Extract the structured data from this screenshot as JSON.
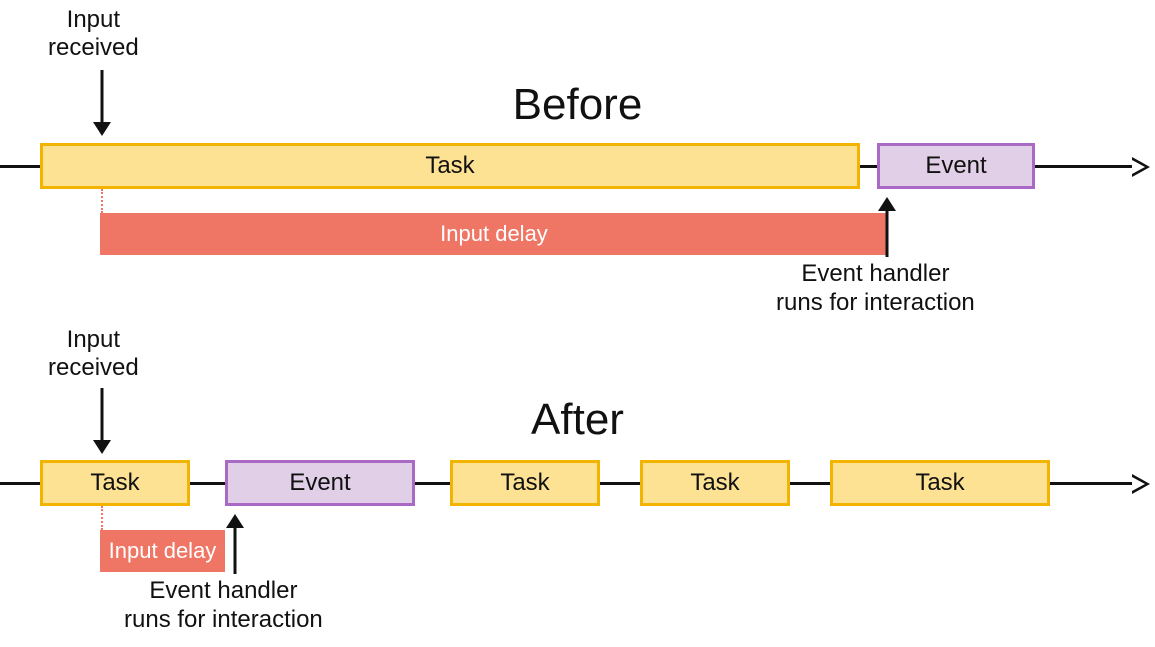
{
  "before": {
    "title": "Before",
    "input_label": "Input\nreceived",
    "task_label": "Task",
    "event_label": "Event",
    "delay_label": "Input delay",
    "handler_label": "Event handler\nruns for interaction"
  },
  "after": {
    "title": "After",
    "input_label": "Input\nreceived",
    "task_labels": [
      "Task",
      "Task",
      "Task",
      "Task"
    ],
    "event_label": "Event",
    "delay_label": "Input delay",
    "handler_label": "Event handler\nruns for interaction"
  },
  "colors": {
    "task_fill": "#fde293",
    "task_border": "#f3b401",
    "event_fill": "#e1cfe8",
    "event_border": "#ab69c6",
    "delay_fill": "#ef7564",
    "line": "#111111"
  },
  "chart_data": {
    "type": "timeline-diagram",
    "description": "Comparison of input delay before and after breaking a long task into smaller chunks.",
    "before": {
      "timeline": [
        {
          "kind": "task",
          "label": "Task",
          "approx_width_share": 0.74
        },
        {
          "kind": "event",
          "label": "Event",
          "approx_width_share": 0.14
        }
      ],
      "input_received_at_share": 0.06,
      "input_delay_span_share": [
        0.06,
        0.8
      ],
      "event_handler_at_share": 0.8
    },
    "after": {
      "timeline": [
        {
          "kind": "task",
          "label": "Task",
          "approx_width_share": 0.13
        },
        {
          "kind": "event",
          "label": "Event",
          "approx_width_share": 0.17
        },
        {
          "kind": "task",
          "label": "Task",
          "approx_width_share": 0.13
        },
        {
          "kind": "task",
          "label": "Task",
          "approx_width_share": 0.13
        },
        {
          "kind": "task",
          "label": "Task",
          "approx_width_share": 0.13
        }
      ],
      "input_received_at_share": 0.06,
      "input_delay_span_share": [
        0.06,
        0.17
      ],
      "event_handler_at_share": 0.17
    }
  }
}
